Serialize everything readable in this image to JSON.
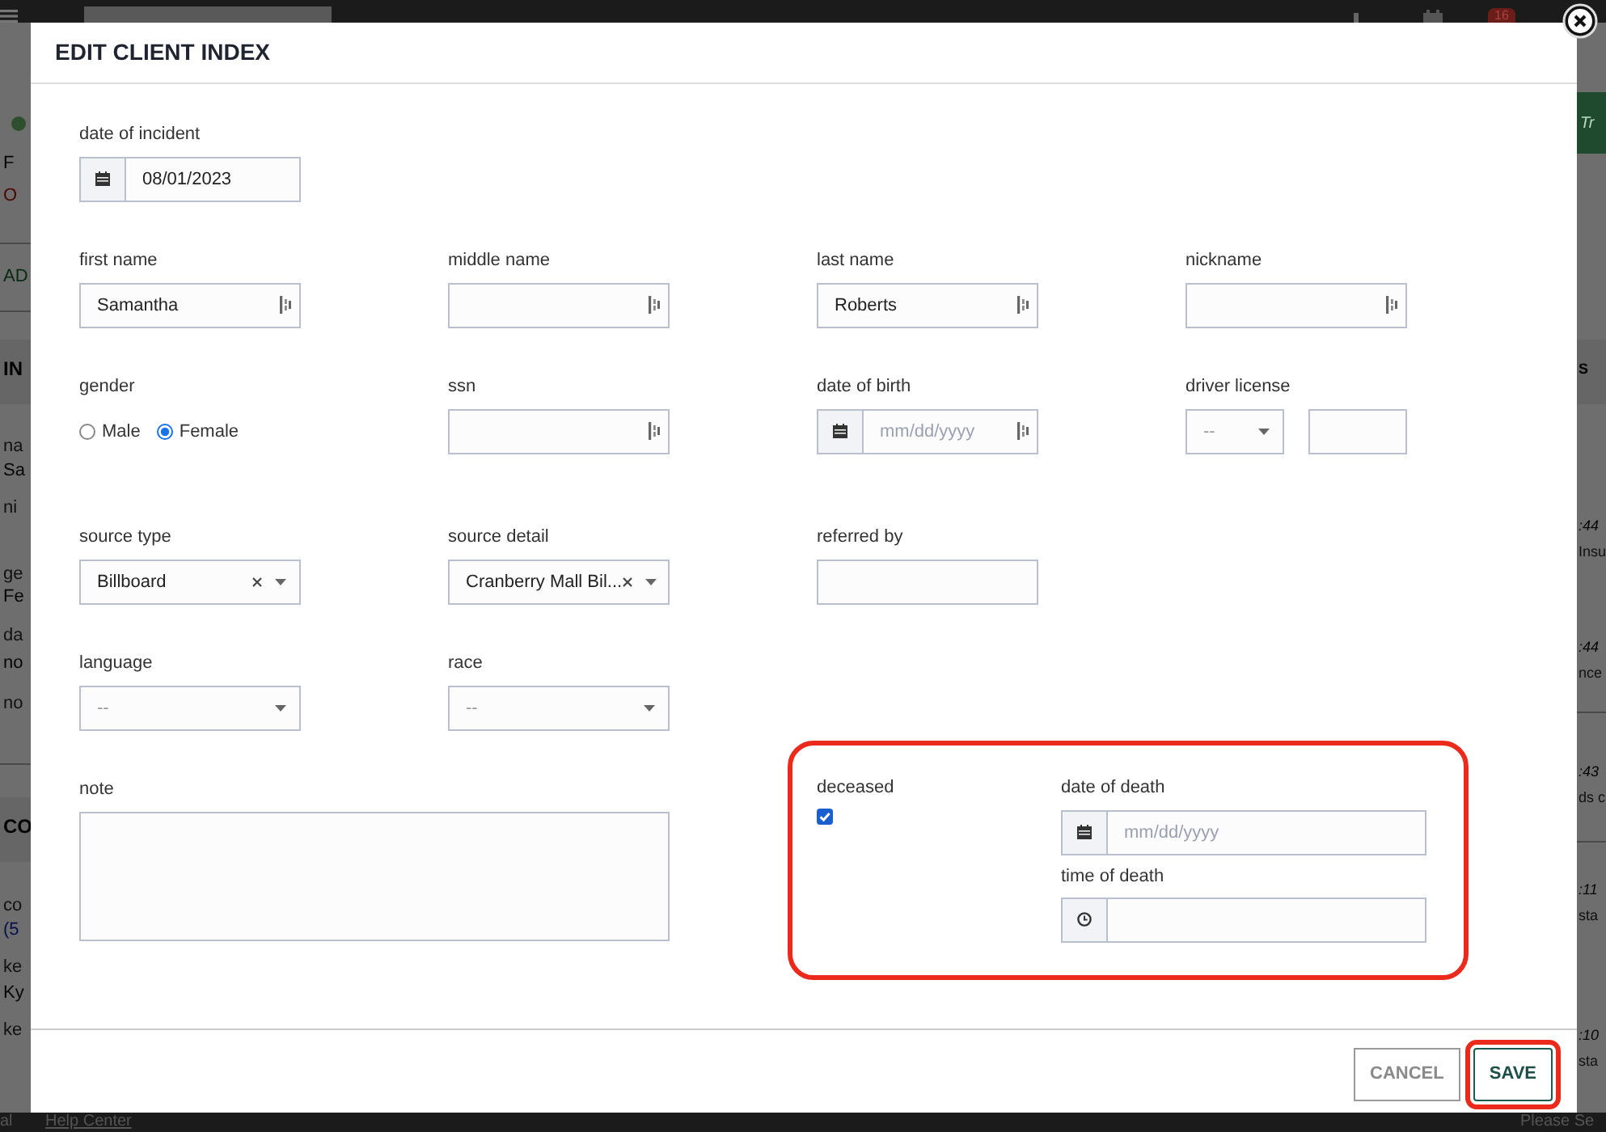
{
  "background": {
    "top_badge": "16",
    "left": [
      {
        "text": "F",
        "kind": "plain"
      },
      {
        "text": "O",
        "kind": "alert"
      },
      {
        "text": "AD",
        "kind": "accent"
      },
      {
        "text": "IN",
        "kind": "heading"
      },
      {
        "text": "na",
        "kind": "label"
      },
      {
        "text": "Sa",
        "kind": "plain"
      },
      {
        "text": "ni",
        "kind": "label"
      },
      {
        "text": "ge",
        "kind": "label"
      },
      {
        "text": "Fe",
        "kind": "plain"
      },
      {
        "text": "da",
        "kind": "label"
      },
      {
        "text": "no",
        "kind": "plain"
      },
      {
        "text": "no",
        "kind": "label"
      },
      {
        "text": "CO",
        "kind": "heading"
      },
      {
        "text": "co",
        "kind": "label"
      },
      {
        "text": "(5",
        "kind": "link"
      },
      {
        "text": "ke",
        "kind": "label"
      },
      {
        "text": "Ky",
        "kind": "plain"
      },
      {
        "text": "ke",
        "kind": "label"
      }
    ],
    "right": [
      {
        "text": "Tr",
        "kind": "accent"
      },
      {
        "text": "S",
        "kind": "heading"
      },
      {
        "text": ":44",
        "kind": "time"
      },
      {
        "text": "Insu",
        "kind": "label"
      },
      {
        "text": ":44",
        "kind": "time"
      },
      {
        "text": "nce",
        "kind": "label"
      },
      {
        "text": ":43",
        "kind": "time"
      },
      {
        "text": "ds c",
        "kind": "label"
      },
      {
        "text": ":11",
        "kind": "time"
      },
      {
        "text": "sta",
        "kind": "label"
      },
      {
        "text": ":10",
        "kind": "time"
      },
      {
        "text": "sta",
        "kind": "label"
      }
    ],
    "footer_left": "al",
    "footer_link": "Help Center",
    "footer_right": "Please Se"
  },
  "dialog": {
    "title": "EDIT CLIENT INDEX",
    "rows": [
      [
        {
          "kind": "date",
          "label": "date of incident",
          "value": "08/01/2023",
          "handle": false
        }
      ],
      [
        {
          "kind": "text",
          "label": "first name",
          "value": "Samantha",
          "handle": true
        },
        {
          "kind": "text",
          "label": "middle name",
          "handle": true
        },
        {
          "kind": "text",
          "label": "last name",
          "value": "Roberts",
          "handle": true
        },
        {
          "kind": "text",
          "label": "nickname",
          "handle": true
        }
      ],
      [
        {
          "kind": "radio",
          "label": "gender",
          "options": [
            {
              "label": "Male",
              "selected": false
            },
            {
              "label": "Female",
              "selected": true
            }
          ]
        },
        {
          "kind": "text",
          "label": "ssn",
          "handle": true
        },
        {
          "kind": "date",
          "label": "date of birth",
          "placeholder": "mm/dd/yyyy",
          "handle": true
        },
        {
          "kind": "select_text",
          "label": "driver license",
          "placeholder": "--"
        }
      ],
      [
        {
          "kind": "select",
          "label": "source type",
          "value": "Billboard",
          "clearable": true
        },
        {
          "kind": "select",
          "label": "source detail",
          "value": "Cranberry Mall Bil...",
          "clearable": true
        },
        {
          "kind": "text",
          "label": "referred by",
          "handle": false
        }
      ],
      [
        {
          "kind": "select",
          "label": "language",
          "placeholder": "--",
          "clearable": false
        },
        {
          "kind": "select",
          "label": "race",
          "placeholder": "--",
          "clearable": false
        }
      ]
    ],
    "note": {
      "kind": "textarea",
      "label": "note"
    },
    "deceased": {
      "kind": "deceased",
      "label": "deceased",
      "checked": true,
      "highlighted": true,
      "date_label": "date of death",
      "date_placeholder": "mm/dd/yyyy",
      "time_label": "time of death"
    },
    "buttons": [
      {
        "label": "CANCEL",
        "kind": "secondary",
        "highlighted": false
      },
      {
        "label": "SAVE",
        "kind": "primary",
        "highlighted": true
      }
    ]
  }
}
